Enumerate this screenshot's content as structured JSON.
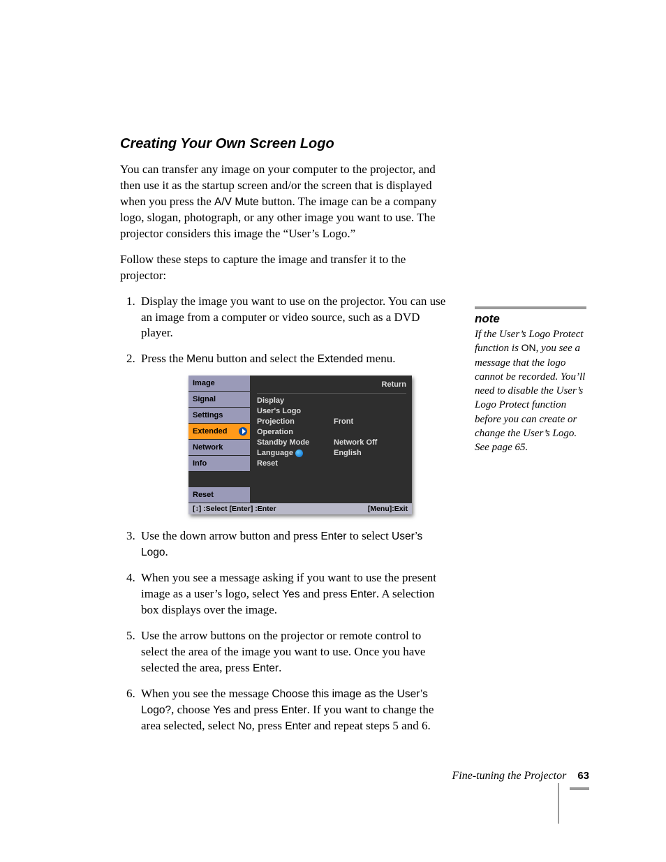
{
  "title": "Creating Your Own Screen Logo",
  "intro_pre": "You can transfer any image on your computer to the projector, and then use it as the startup screen and/or the screen that is displayed when you press the ",
  "intro_btn": "A/V Mute",
  "intro_post": " button. The image can be a company logo, slogan, photograph, or any other image you want to use. The projector considers this image the “User’s Logo.”",
  "lead": "Follow these steps to capture the image and transfer it to the projector:",
  "steps": {
    "s1": "Display the image you want to use on the projector. You can use an image from a computer or video source, such as a DVD player.",
    "s2_a": "Press the ",
    "s2_b": "Menu",
    "s2_c": " button and select the ",
    "s2_d": "Extended",
    "s2_e": " menu.",
    "s3_a": "Use the down arrow button and press ",
    "s3_b": "Enter",
    "s3_c": " to select ",
    "s3_d": "User’s Logo",
    "s3_e": ".",
    "s4_a": "When you see a message asking if you want to use the present image as a user’s logo, select ",
    "s4_b": "Yes",
    "s4_c": " and press ",
    "s4_d": "Enter",
    "s4_e": ". A selection box displays over the image.",
    "s5_a": "Use the arrow buttons on the projector or remote control to select the area of the image you want to use. Once you have selected the area, press ",
    "s5_b": "Enter",
    "s5_c": ".",
    "s6_a": "When you see the message ",
    "s6_b": "Choose this image as the User’s Logo?",
    "s6_c": ", choose ",
    "s6_d": "Yes",
    "s6_e": " and press ",
    "s6_f": "Enter",
    "s6_g": ". If you want to change the area selected, select ",
    "s6_h": "No",
    "s6_i": ", press ",
    "s6_j": "Enter",
    "s6_k": " and repeat steps 5 and 6."
  },
  "note": {
    "heading": "note",
    "a": "If the User’s Logo Protect function is ",
    "b": "ON",
    "c": ", you see a message that the logo cannot be recorded. You’ll need to disable the User’s Logo Protect function before you can create or change the User’s Logo. See page 65."
  },
  "menu": {
    "left": [
      "Image",
      "Signal",
      "Settings",
      "Extended",
      "Network",
      "Info",
      "Reset"
    ],
    "return": "Return",
    "rows": [
      {
        "lbl": "Display",
        "val": ""
      },
      {
        "lbl": "User's Logo",
        "val": ""
      },
      {
        "lbl": "Projection",
        "val": "Front"
      },
      {
        "lbl": "Operation",
        "val": ""
      },
      {
        "lbl": "Standby Mode",
        "val": "Network Off"
      },
      {
        "lbl": "Language",
        "val": "English",
        "globe": true
      },
      {
        "lbl": "Reset",
        "val": ""
      }
    ],
    "help_left": "[↕] :Select  [Enter] :Enter",
    "help_right": "[Menu]:Exit"
  },
  "footer": {
    "section": "Fine-tuning the Projector",
    "page": "63"
  }
}
